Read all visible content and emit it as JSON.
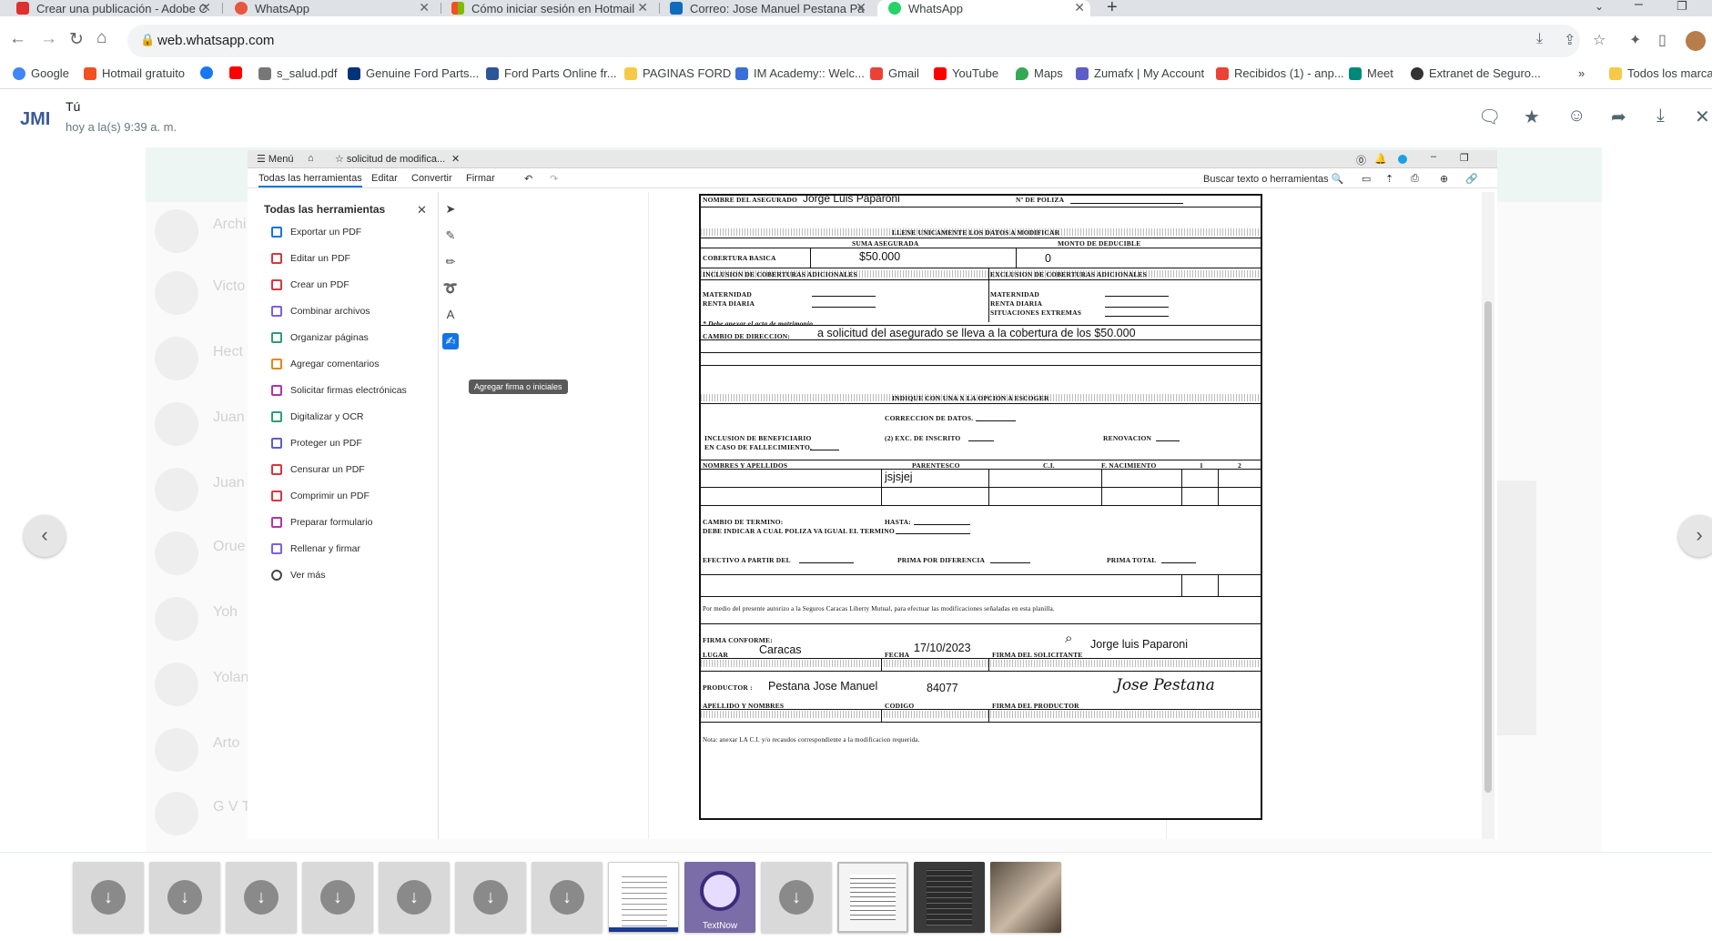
{
  "browser": {
    "tabs": [
      {
        "title": "Crear una publicación - Adobe C",
        "icon": "adobe-icon",
        "color": "#e02f2f"
      },
      {
        "title": "WhatsApp",
        "icon": "whatsapp-icon",
        "color": "#e8553e"
      },
      {
        "title": "Cómo iniciar sesión en Hotmail",
        "icon": "microsoft-icon",
        "color": "#f25022"
      },
      {
        "title": "Correo: Jose Manuel Pestana Pa",
        "icon": "outlook-icon",
        "color": "#0f6cbd"
      },
      {
        "title": "WhatsApp",
        "icon": "whatsapp-icon",
        "color": "#25d366"
      }
    ],
    "active_tab": 4,
    "url": "web.whatsapp.com",
    "bookmarks": [
      {
        "label": "Google",
        "color": "#4285f4"
      },
      {
        "label": "Hotmail gratuito",
        "color": "#f25022"
      },
      {
        "label": "",
        "color": "#1877f2"
      },
      {
        "label": "",
        "color": "#ff0000"
      },
      {
        "label": "s_salud.pdf",
        "color": "#777777"
      },
      {
        "label": "Genuine Ford Parts...",
        "color": "#003478"
      },
      {
        "label": "Ford Parts Online fr...",
        "color": "#2b5797"
      },
      {
        "label": "PAGINAS FORD",
        "color": "#f7c948"
      },
      {
        "label": "IM Academy:: Welc...",
        "color": "#3b6fd8"
      },
      {
        "label": "Gmail",
        "color": "#ea4335"
      },
      {
        "label": "YouTube",
        "color": "#ff0000"
      },
      {
        "label": "Maps",
        "color": "#34a853"
      },
      {
        "label": "Zumafx | My Account",
        "color": "#5b5fc7"
      },
      {
        "label": "Recibidos (1) - anp...",
        "color": "#ea4335"
      },
      {
        "label": "Meet",
        "color": "#00897b"
      },
      {
        "label": "Extranet de Seguro...",
        "color": "#333333"
      }
    ],
    "more_bookmarks": "»",
    "all_bookmarks": "Todos los marcad"
  },
  "viewer": {
    "sender": "Tú",
    "time": "hoy a la(s) 9:39 a. m.",
    "prev": "‹",
    "next": "›",
    "ghost_rows": [
      "Archi",
      "Victo",
      "Hect",
      "Juan",
      "Juan",
      "Orue",
      "Yoh",
      "Yolan",
      "Arto",
      "G V T"
    ]
  },
  "acrobat": {
    "menu": "Menú",
    "doc_tab": "solicitud de modifica...",
    "menubar": [
      "Todas las herramientas",
      "Editar",
      "Convertir",
      "Firmar"
    ],
    "search": "Buscar texto o herramientas",
    "panel_title": "Todas las herramientas",
    "tools": [
      {
        "label": "Exportar un PDF",
        "color": "#1473e6"
      },
      {
        "label": "Editar un PDF",
        "color": "#d7373f"
      },
      {
        "label": "Crear un PDF",
        "color": "#d7373f"
      },
      {
        "label": "Combinar archivos",
        "color": "#7e5fe0"
      },
      {
        "label": "Organizar páginas",
        "color": "#2d9d78"
      },
      {
        "label": "Agregar comentarios",
        "color": "#e68619"
      },
      {
        "label": "Solicitar firmas electrónicas",
        "color": "#b134a7"
      },
      {
        "label": "Digitalizar y OCR",
        "color": "#2d9d78"
      },
      {
        "label": "Proteger un PDF",
        "color": "#5b5fc7"
      },
      {
        "label": "Censurar un PDF",
        "color": "#d7373f"
      },
      {
        "label": "Comprimir un PDF",
        "color": "#d7373f"
      },
      {
        "label": "Preparar formulario",
        "color": "#b134a7"
      },
      {
        "label": "Rellenar y firmar",
        "color": "#7e5fe0"
      },
      {
        "label": "Ver más",
        "color": "#444444"
      }
    ],
    "tooltip": "Agregar firma o iniciales"
  },
  "form": {
    "l_nombre": "NOMBRE DEL ASEGURADO",
    "v_nombre": "Jorge Luis Paparoni",
    "l_poliza": "Nº DE POLIZA",
    "h_llene": "LLENE UNICAMENTE LOS DATOS A MODIFICAR",
    "h_suma": "SUMA ASEGURADA",
    "h_monto": "MONTO DE DEDUCIBLE",
    "l_cobertura": "COBERTURA BASICA",
    "v_suma": "$50.000",
    "v_deducible": "0",
    "h_inclusion": "INCLUSION DE COBERTURAS ADICIONALES",
    "h_exclusion": "EXCLUSION DE COBERTURAS ADICIONALES",
    "l_maternidad": "MATERNIDAD",
    "l_renta": "RENTA DIARIA",
    "l_situaciones": "SITUACIONES EXTREMAS",
    "note_acta": "* Debe anexar el acta de matrimonio",
    "l_cambio_dir": "CAMBIO DE DIRECCION:",
    "v_cambio_dir": "a solicitud del asegurado se lleva a la cobertura de los $50.000",
    "h_indique": "INDIQUE CON UNA X LA OPCION A ESCOGER",
    "l_correccion": "CORRECCION DE DATOS.",
    "l_beneficiario_1": "INCLUSION DE BENEFICIARIO",
    "l_beneficiario_2": "EN CASO DE FALLECIMIENTO.",
    "l_exc": "(2) EXC. DE INSCRITO",
    "l_renovacion": "RENOVACION",
    "h_cols": [
      "NOMBRES Y APELLIDOS",
      "PARENTESCO",
      "C.I.",
      "F. NACIMIENTO",
      "1",
      "2"
    ],
    "v_parentesco": "jsjsjej",
    "l_cambio_term_1": "CAMBIO DE TERMINO:",
    "l_cambio_term_2": "DEBE INDICAR A CUAL POLIZA VA IGUAL EL TERMINO",
    "l_hasta": "HASTA:",
    "l_efectivo": "EFECTIVO A PARTIR DEL",
    "l_prima_dif": "PRIMA POR DIFERENCIA",
    "l_prima_total": "PRIMA TOTAL",
    "autorizo": "Por medio del presente autorizo a la Seguros Caracas Liberty Mutual, para efectuar las modificaciones señaladas en esta planilla.",
    "l_firma_conforme": "FIRMA CONFORME:",
    "l_lugar": "LUGAR",
    "v_lugar": "Caracas",
    "l_fecha": "FECHA",
    "v_fecha": "17/10/2023",
    "l_firma_solicitante": "FIRMA DEL SOLICITANTE",
    "v_solicitante": "Jorge luis Paparoni",
    "l_productor": "PRODUCTOR :",
    "v_productor": "Pestana Jose Manuel",
    "v_codigo": "84077",
    "l_apellido": "APELLIDO Y NOMBRES",
    "l_codigo": "CODIGO",
    "l_firma_productor": "FIRMA DEL PRODUCTOR",
    "v_firma": "Jose Pestana",
    "nota": "Nota: anexar LA C.I. y/o recaudos correspondiente a la modificacion requerida."
  },
  "media": {
    "textnow_label": "TextNow",
    "download_glyph": "↓"
  }
}
